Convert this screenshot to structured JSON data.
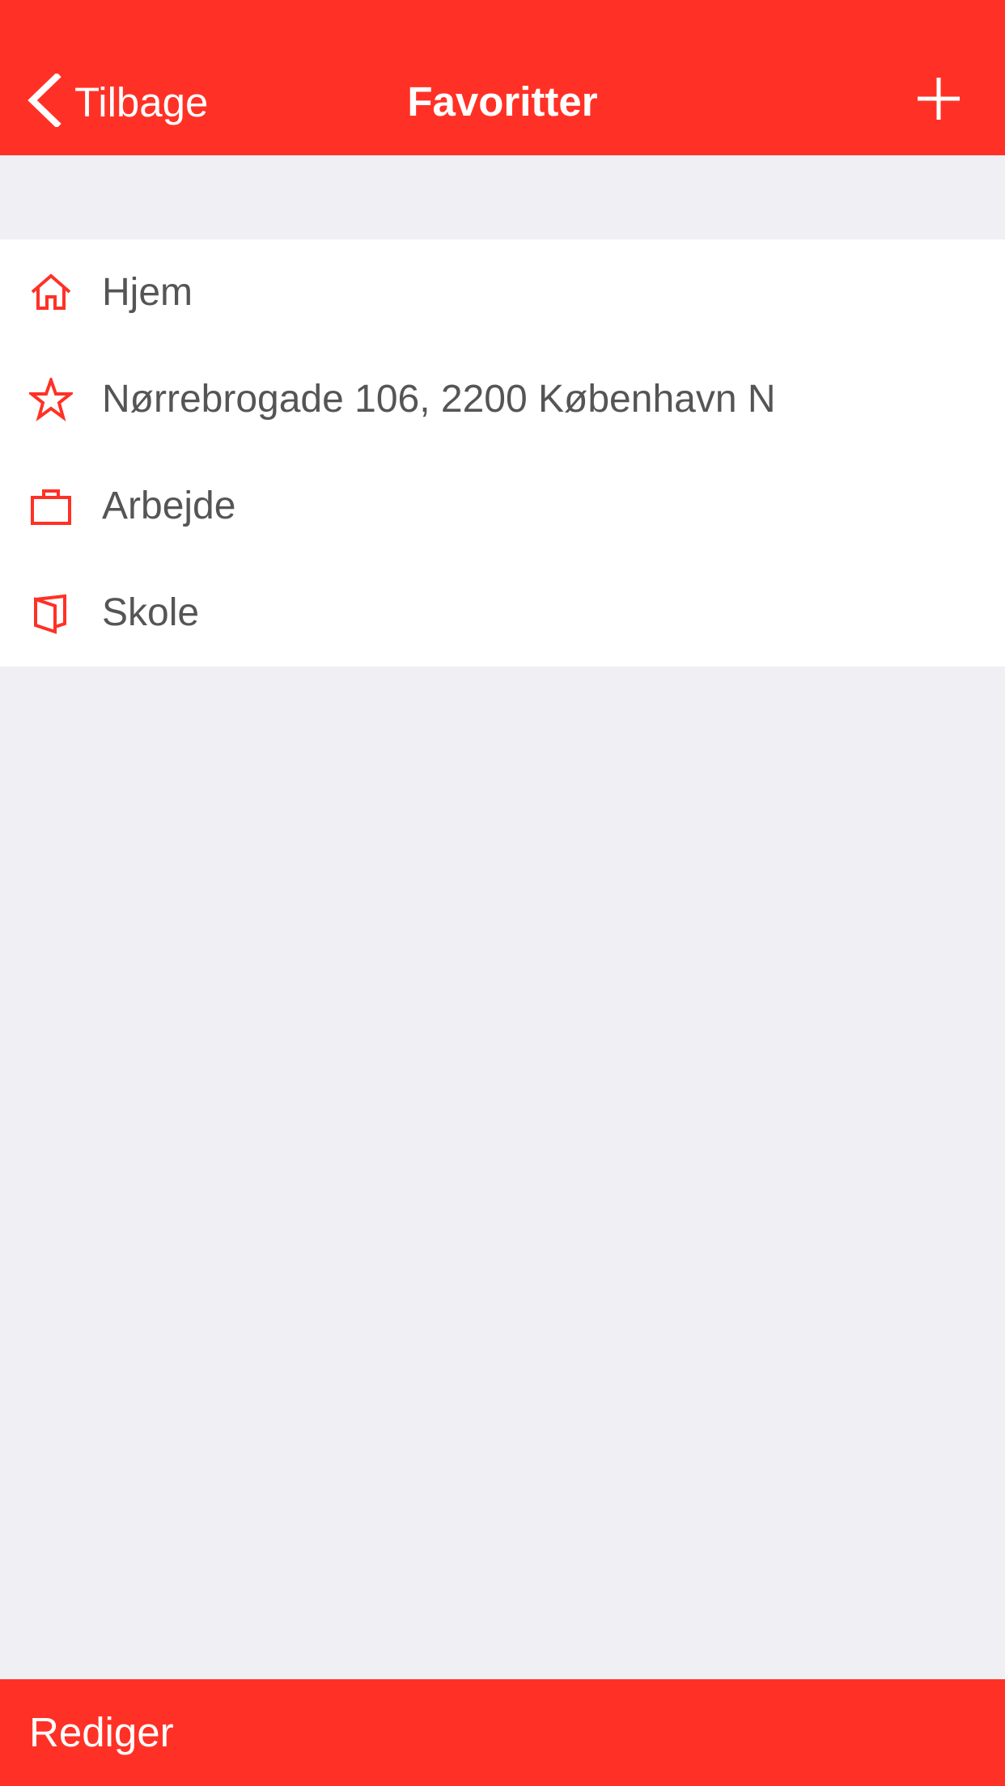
{
  "colors": {
    "accent": "#ff3126",
    "background": "#efeff4",
    "text": "#555555"
  },
  "navbar": {
    "back_label": "Tilbage",
    "title": "Favoritter",
    "add_icon": "plus-icon",
    "back_icon": "chevron-left-icon"
  },
  "favorites": [
    {
      "icon": "home-icon",
      "label": "Hjem"
    },
    {
      "icon": "star-icon",
      "label": "Nørrebrogade 106, 2200 København N"
    },
    {
      "icon": "briefcase-icon",
      "label": "Arbejde"
    },
    {
      "icon": "book-icon",
      "label": "Skole"
    }
  ],
  "toolbar": {
    "edit_label": "Rediger"
  }
}
